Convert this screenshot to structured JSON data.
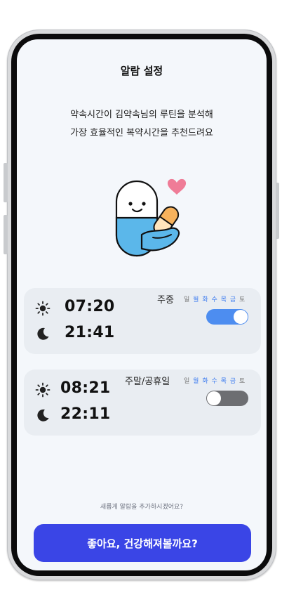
{
  "header": {
    "title": "알람 설정"
  },
  "intro": {
    "line1": "약속시간이 김약속님의 루틴을 분석해",
    "line2": "가장 효율적인  복약시간을 추천드려요"
  },
  "alarms": [
    {
      "label": "주중",
      "days": [
        {
          "name": "일",
          "active": false
        },
        {
          "name": "월",
          "active": true
        },
        {
          "name": "화",
          "active": true
        },
        {
          "name": "수",
          "active": true
        },
        {
          "name": "목",
          "active": true
        },
        {
          "name": "금",
          "active": true
        },
        {
          "name": "토",
          "active": false
        }
      ],
      "morning_time": "07:20",
      "night_time": "21:41",
      "enabled": true
    },
    {
      "label": "주말/공휴일",
      "days": [
        {
          "name": "일",
          "active": true
        },
        {
          "name": "월",
          "active": false
        },
        {
          "name": "화",
          "active": false
        },
        {
          "name": "수",
          "active": false
        },
        {
          "name": "목",
          "active": false
        },
        {
          "name": "금",
          "active": false
        },
        {
          "name": "토",
          "active": true
        }
      ],
      "morning_time": "08:21",
      "night_time": "22:11",
      "enabled": false
    }
  ],
  "footer": {
    "hint": "새롭게 알람을 추가하시겠어요?",
    "confirm_label": "좋아요, 건강해져볼까요?"
  },
  "icons": {
    "morning": "sun-icon",
    "night": "moon-icon",
    "illustration": "pill-mascot-illustration",
    "heart": "heart-icon"
  },
  "colors": {
    "accent": "#3a45e6",
    "toggle_on": "#4d8df0",
    "toggle_off": "#6d6e72",
    "active_day": "#3c7bf0",
    "pill_blue": "#5bb7ea",
    "heart": "#ef7c97"
  }
}
